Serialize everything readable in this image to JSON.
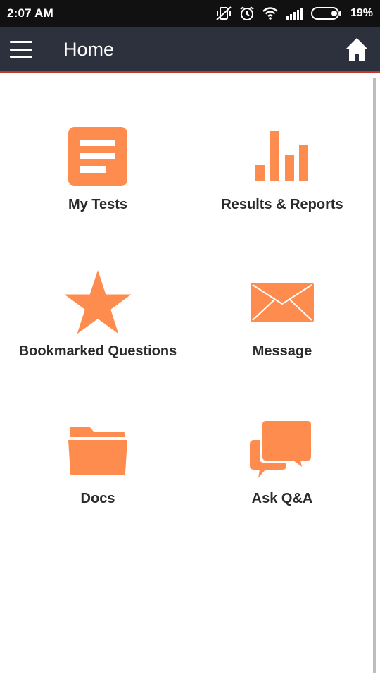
{
  "status_bar": {
    "time": "2:07 AM",
    "battery": "19%",
    "icons": [
      "vibrate-off-icon",
      "alarm-icon",
      "wifi-icon",
      "signal-icon",
      "battery-icon"
    ]
  },
  "app_bar": {
    "title": "Home",
    "menu_icon": "hamburger-menu-icon",
    "home_icon": "home-icon"
  },
  "accent_color": "#ff8c4f",
  "header_color": "#2d313e",
  "tiles": [
    {
      "label": "My Tests",
      "icon": "document-icon"
    },
    {
      "label": "Results & Reports",
      "icon": "bar-chart-icon"
    },
    {
      "label": "Bookmarked Questions",
      "icon": "star-icon"
    },
    {
      "label": "Message",
      "icon": "envelope-icon"
    },
    {
      "label": "Docs",
      "icon": "folder-icon"
    },
    {
      "label": "Ask Q&A",
      "icon": "chat-bubbles-icon"
    }
  ]
}
